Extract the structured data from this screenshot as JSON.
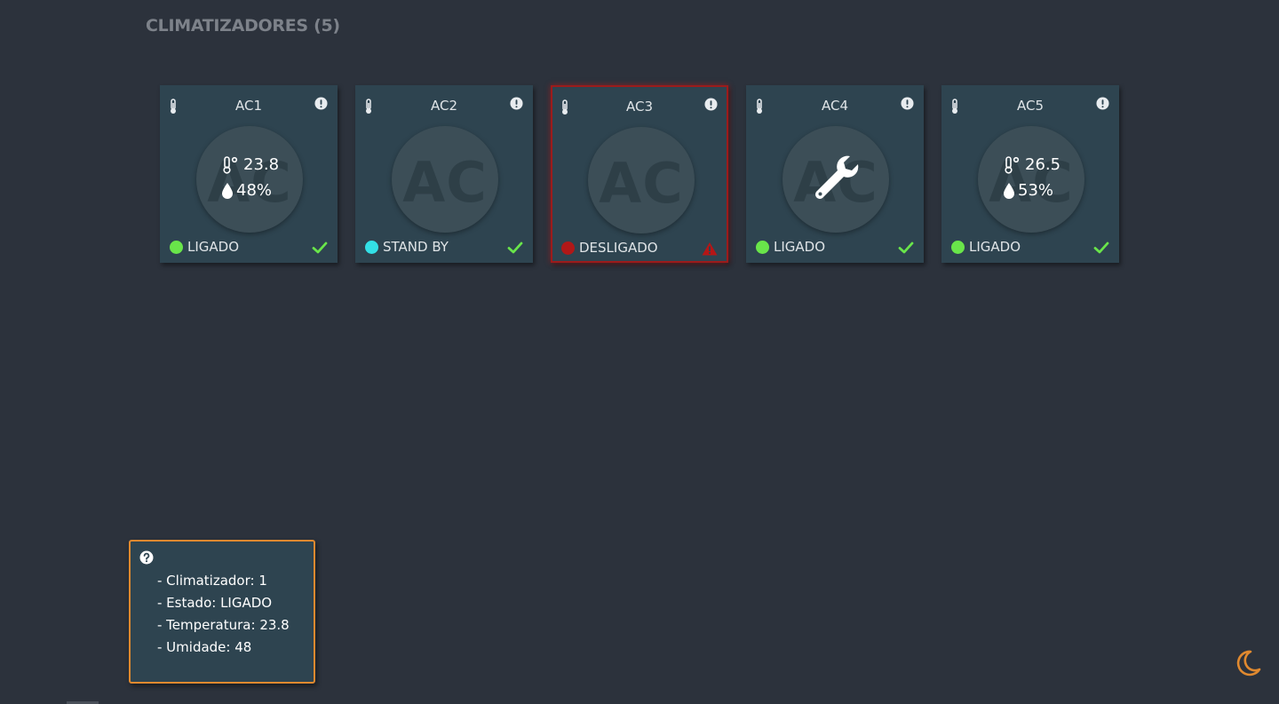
{
  "page": {
    "title": "CLIMATIZADORES (5)"
  },
  "colors": {
    "background": "#2c323c",
    "card": "#2e4450",
    "status_ligado": "#69e54a",
    "status_standby": "#33e0e6",
    "status_desligado": "#b01818",
    "check": "#69e54a",
    "warning": "#b51616",
    "tooltip_border": "#e0892f",
    "theme_icon": "#e0892f"
  },
  "cards": [
    {
      "name": "AC1",
      "temperature": "23.8",
      "humidity": "48%",
      "status": "LIGADO",
      "status_color": "#69e54a",
      "status_icon": "check-icon"
    },
    {
      "name": "AC2",
      "watermark": "AC",
      "status": "STAND BY",
      "status_color": "#33e0e6",
      "status_icon": "check-icon"
    },
    {
      "name": "AC3",
      "watermark": "AC",
      "status": "DESLIGADO",
      "status_color": "#b01818",
      "status_icon": "warning-icon"
    },
    {
      "name": "AC4",
      "watermark": "AC",
      "center_icon": "wrench-icon",
      "status": "LIGADO",
      "status_color": "#69e54a",
      "status_icon": "check-icon"
    },
    {
      "name": "AC5",
      "temperature": "26.5",
      "humidity": "53%",
      "status": "LIGADO",
      "status_color": "#69e54a",
      "status_icon": "check-icon"
    }
  ],
  "tooltip": {
    "icon": "question-circle-icon",
    "lines": [
      "- Climatizador: 1",
      "- Estado: LIGADO",
      "- Temperatura: 23.8",
      "- Umidade: 48"
    ]
  },
  "theme_toggle": {
    "icon": "moon-icon"
  }
}
